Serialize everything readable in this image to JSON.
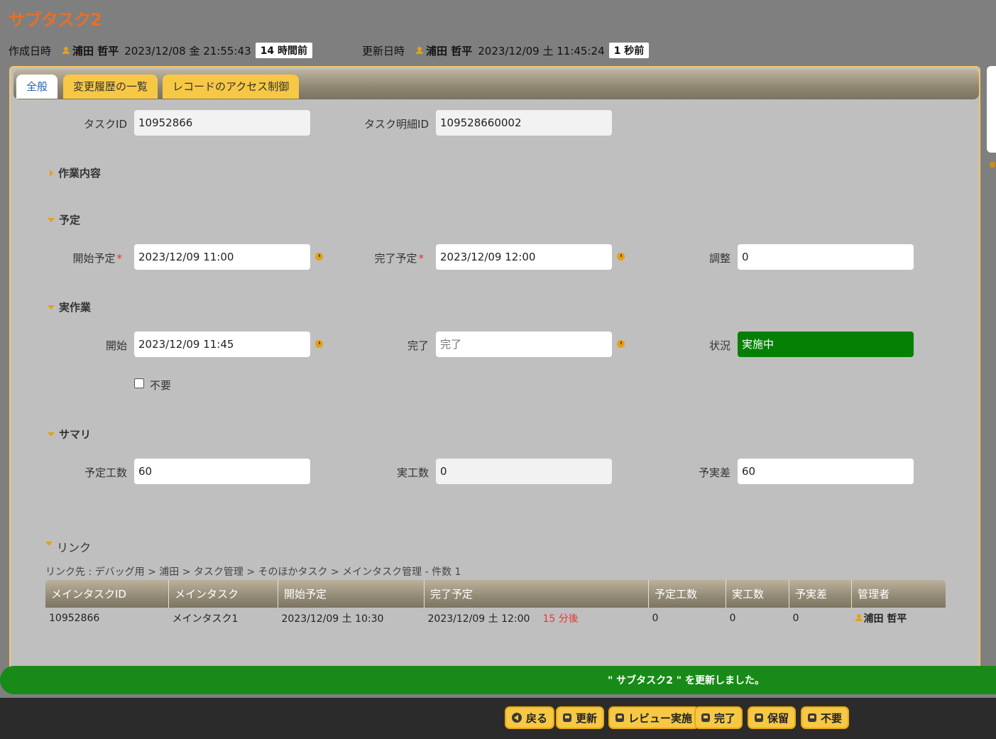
{
  "title": "サブタスク2",
  "created": {
    "label": "作成日時",
    "user": "浦田 哲平",
    "datetime": "2023/12/08 金 21:55:43",
    "ago": "14 時間前"
  },
  "updated": {
    "label": "更新日時",
    "user": "浦田 哲平",
    "datetime": "2023/12/09 土 11:45:24",
    "ago": "1 秒前"
  },
  "tabs": [
    "全般",
    "変更履歴の一覧",
    "レコードのアクセス制御"
  ],
  "form": {
    "task_id": {
      "label": "タスクID",
      "value": "10952866"
    },
    "task_detail_id": {
      "label": "タスク明細ID",
      "value": "109528660002"
    },
    "section_work": "作業内容",
    "section_plan": "予定",
    "plan_start": {
      "label": "開始予定",
      "required": "*",
      "value": "2023/12/09 11:00"
    },
    "plan_end": {
      "label": "完了予定",
      "required": "*",
      "value": "2023/12/09 12:00"
    },
    "adjust": {
      "label": "調整",
      "value": "0"
    },
    "section_actual": "実作業",
    "actual_start": {
      "label": "開始",
      "value": "2023/12/09 11:45"
    },
    "actual_end": {
      "label": "完了",
      "placeholder": "完了"
    },
    "status": {
      "label": "状況",
      "value": "実施中"
    },
    "not_needed": "不要",
    "section_summary": "サマリ",
    "planned_hours": {
      "label": "予定工数",
      "value": "60"
    },
    "actual_hours": {
      "label": "実工数",
      "value": "0"
    },
    "diff_hours": {
      "label": "予実差",
      "value": "60"
    }
  },
  "link": {
    "heading": "リンク",
    "path": "リンク先 : デバッグ用 > 浦田 > タスク管理 > そのほかタスク > メインタスク管理 - 件数 1",
    "columns": [
      "メインタスクID",
      "メインタスク",
      "開始予定",
      "完了予定",
      "予定工数",
      "実工数",
      "予実差",
      "管理者"
    ],
    "row": {
      "id": "10952866",
      "name": "メインタスク1",
      "start": "2023/12/09 土 10:30",
      "end": "2023/12/09 土 12:00",
      "due": "15 分後",
      "planned": "0",
      "actual": "0",
      "diff": "0",
      "manager": "浦田 哲平"
    }
  },
  "toast": "\" サブタスク2 \" を更新しました。",
  "buttons": {
    "back": "戻る",
    "update": "更新",
    "review": "レビュー実施",
    "complete": "完了",
    "hold": "保留",
    "unneeded": "不要"
  },
  "colors": {
    "accent": "#f6c846",
    "status_green": "#058005",
    "toast_green": "#188a18",
    "title": "#e4702a"
  }
}
